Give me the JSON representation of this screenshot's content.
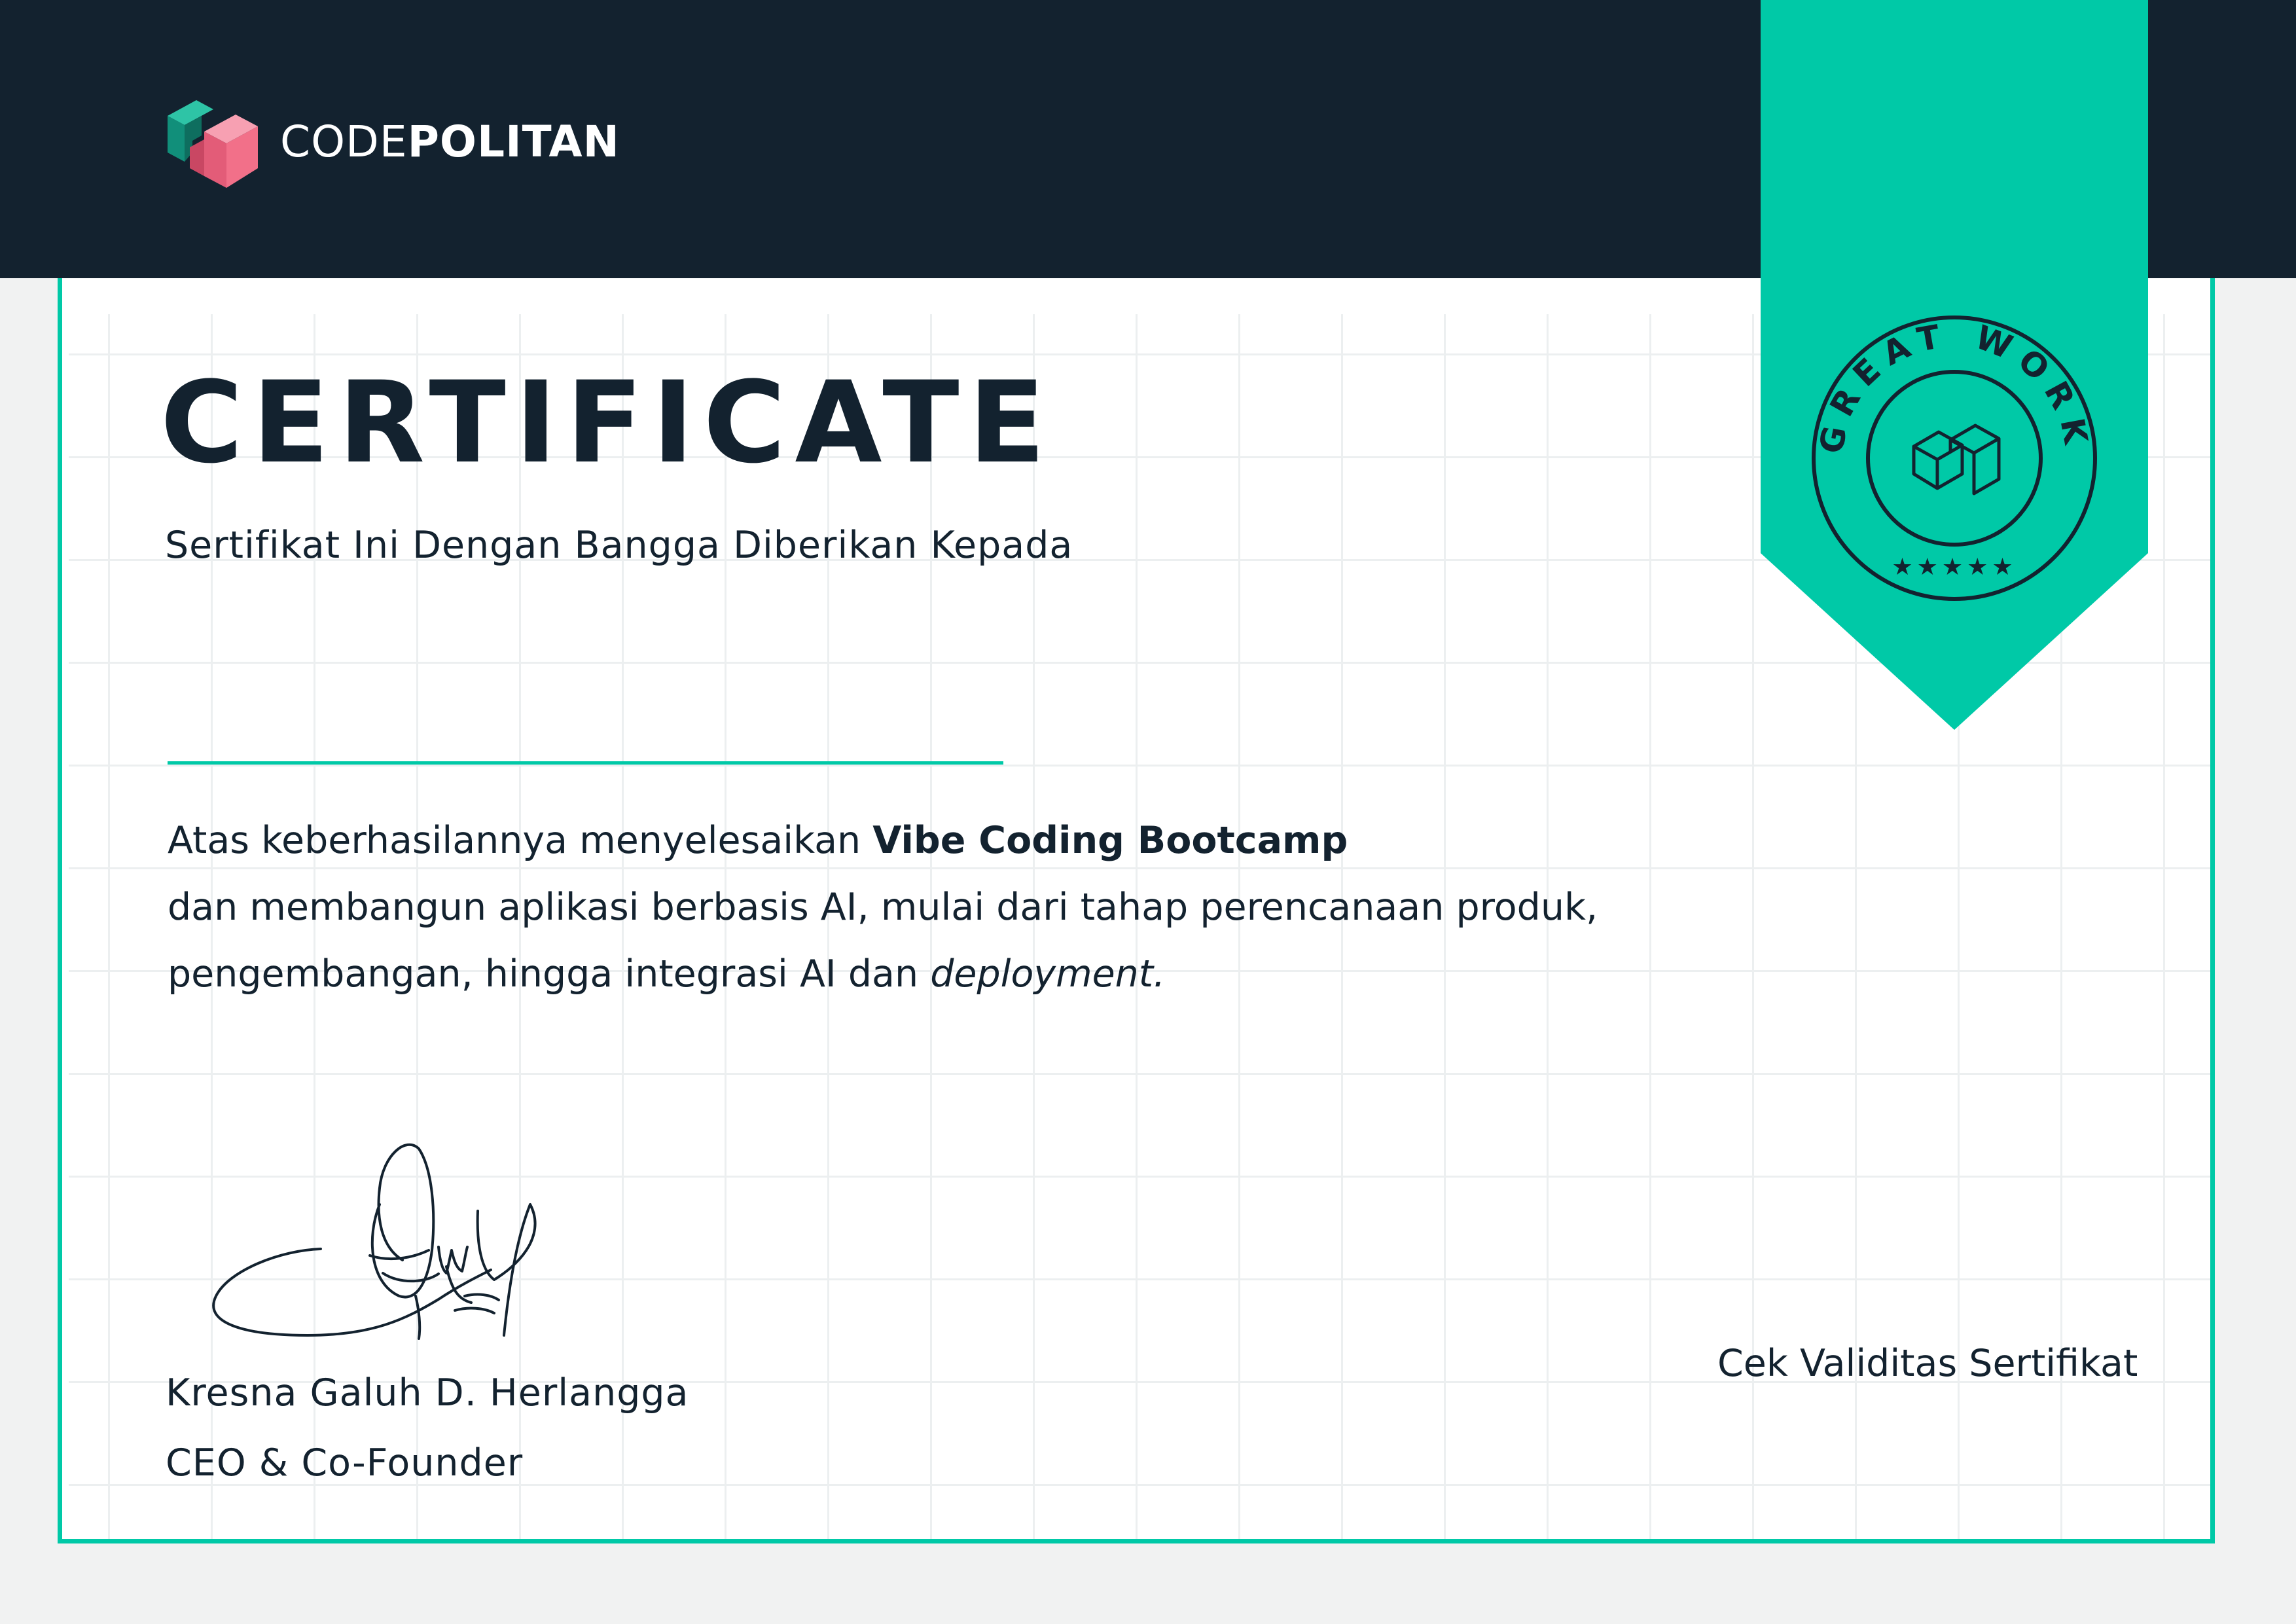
{
  "brand": {
    "logo_icon": "codepolitan-cube-logo",
    "name_light": "CODE",
    "name_bold": "POLITAN"
  },
  "certificate": {
    "title": "CERTIFICATE",
    "subtitle": "Sertifikat Ini Dengan Bangga Diberikan Kepada",
    "recipient_name": "",
    "body": {
      "line1_prefix": "Atas keberhasilannya menyelesaikan ",
      "course": "Vibe Coding Bootcamp",
      "line2": "dan membangun aplikasi berbasis AI, mulai dari tahap perencanaan produk,",
      "line3_prefix": "pengembangan, hingga integrasi AI dan ",
      "line3_italic": "deployment."
    },
    "signer": {
      "name": "Kresna Galuh D. Herlangga",
      "role": "CEO & Co-Founder"
    },
    "validity_link": "Cek Validitas Sertifikat"
  },
  "badge": {
    "text": "GREAT WORK",
    "stars": "★★★★★"
  },
  "colors": {
    "header": "#13222f",
    "accent": "#00c9a7",
    "logo_pink": "#f27089",
    "logo_teal": "#1aa88f"
  }
}
